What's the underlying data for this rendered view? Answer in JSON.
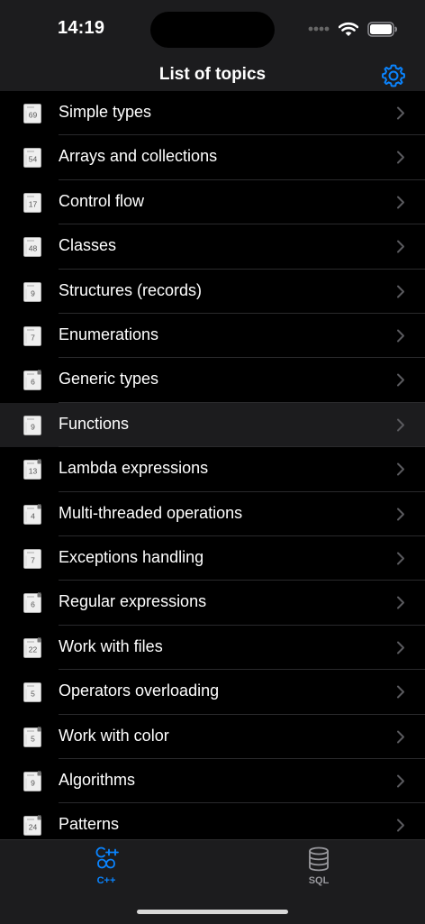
{
  "status_bar": {
    "time": "14:19"
  },
  "nav": {
    "title": "List of topics",
    "settings_icon": "gear-icon"
  },
  "colors": {
    "accent": "#0a84ff",
    "background": "#000000",
    "bar": "#1c1c1e",
    "chevron": "#5a5a5e"
  },
  "topics": [
    {
      "label": "Simple types",
      "count": "69",
      "locked": false,
      "selected": false
    },
    {
      "label": "Arrays and collections",
      "count": "54",
      "locked": false,
      "selected": false
    },
    {
      "label": "Control flow",
      "count": "17",
      "locked": false,
      "selected": false
    },
    {
      "label": "Classes",
      "count": "48",
      "locked": false,
      "selected": false
    },
    {
      "label": "Structures (records)",
      "count": "9",
      "locked": false,
      "selected": false
    },
    {
      "label": "Enumerations",
      "count": "7",
      "locked": false,
      "selected": false
    },
    {
      "label": "Generic types",
      "count": "6",
      "locked": true,
      "selected": false
    },
    {
      "label": "Functions",
      "count": "9",
      "locked": false,
      "selected": true
    },
    {
      "label": "Lambda expressions",
      "count": "13",
      "locked": true,
      "selected": false
    },
    {
      "label": "Multi-threaded operations",
      "count": "4",
      "locked": true,
      "selected": false
    },
    {
      "label": "Exceptions handling",
      "count": "7",
      "locked": false,
      "selected": false
    },
    {
      "label": "Regular expressions",
      "count": "6",
      "locked": true,
      "selected": false
    },
    {
      "label": "Work with files",
      "count": "22",
      "locked": true,
      "selected": false
    },
    {
      "label": "Operators overloading",
      "count": "5",
      "locked": false,
      "selected": false
    },
    {
      "label": "Work with color",
      "count": "5",
      "locked": true,
      "selected": false
    },
    {
      "label": "Algorithms",
      "count": "9",
      "locked": true,
      "selected": false
    },
    {
      "label": "Patterns",
      "count": "24",
      "locked": true,
      "selected": false
    }
  ],
  "tabs": [
    {
      "label": "C++",
      "icon": "cpp-icon",
      "active": true
    },
    {
      "label": "SQL",
      "icon": "database-icon",
      "active": false
    }
  ]
}
